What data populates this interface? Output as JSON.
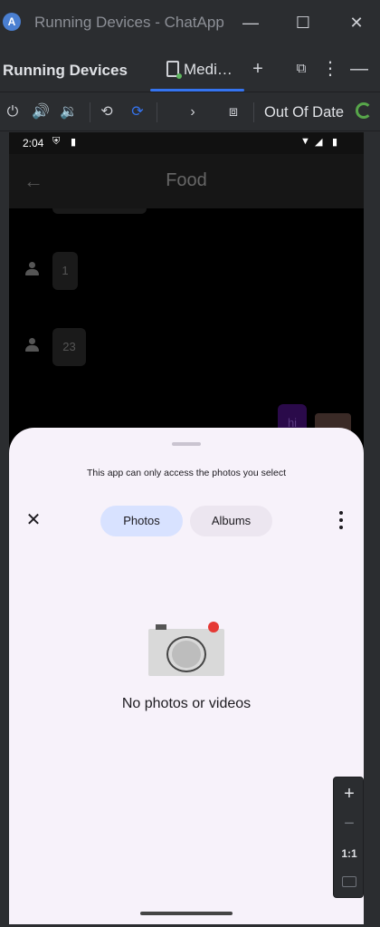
{
  "window": {
    "title": "Running Devices - ChatApp",
    "minimize_icon": "minimize-icon",
    "maximize_icon": "maximize-icon",
    "close_icon": "close-icon"
  },
  "panel": {
    "title": "Running Devices",
    "tab_label": "Medi…",
    "add_icon": "plus-icon",
    "collapse_icon": "collapse-icon",
    "more_icon": "more-icon",
    "hide_icon": "minus-icon"
  },
  "toolbar": {
    "status": "Out Of Date",
    "buttons": [
      "power-icon",
      "volume-up-icon",
      "volume-down-icon",
      "rotate-left-icon",
      "rotate-right-icon",
      "chevron-right-icon",
      "screenshot-icon"
    ]
  },
  "device": {
    "statusbar": {
      "time": "2:04"
    },
    "appbar": {
      "title": "Food"
    },
    "messages": [
      {
        "text": "1",
        "sender": "other"
      },
      {
        "text": "23",
        "sender": "other"
      },
      {
        "text": "hi",
        "sender": "me"
      }
    ],
    "sheet": {
      "notice": "This app can only access the photos you select",
      "tabs": [
        "Photos",
        "Albums"
      ],
      "selected_tab": "Photos",
      "empty_text": "No photos or videos"
    }
  },
  "zoom_controls": {
    "zoom_in": "+",
    "zoom_out": "−",
    "actual_size": "1:1"
  },
  "colors": {
    "accent": "#3574f0",
    "status_ok": "#57a64a",
    "photos_pill": "#d8e2ff"
  }
}
